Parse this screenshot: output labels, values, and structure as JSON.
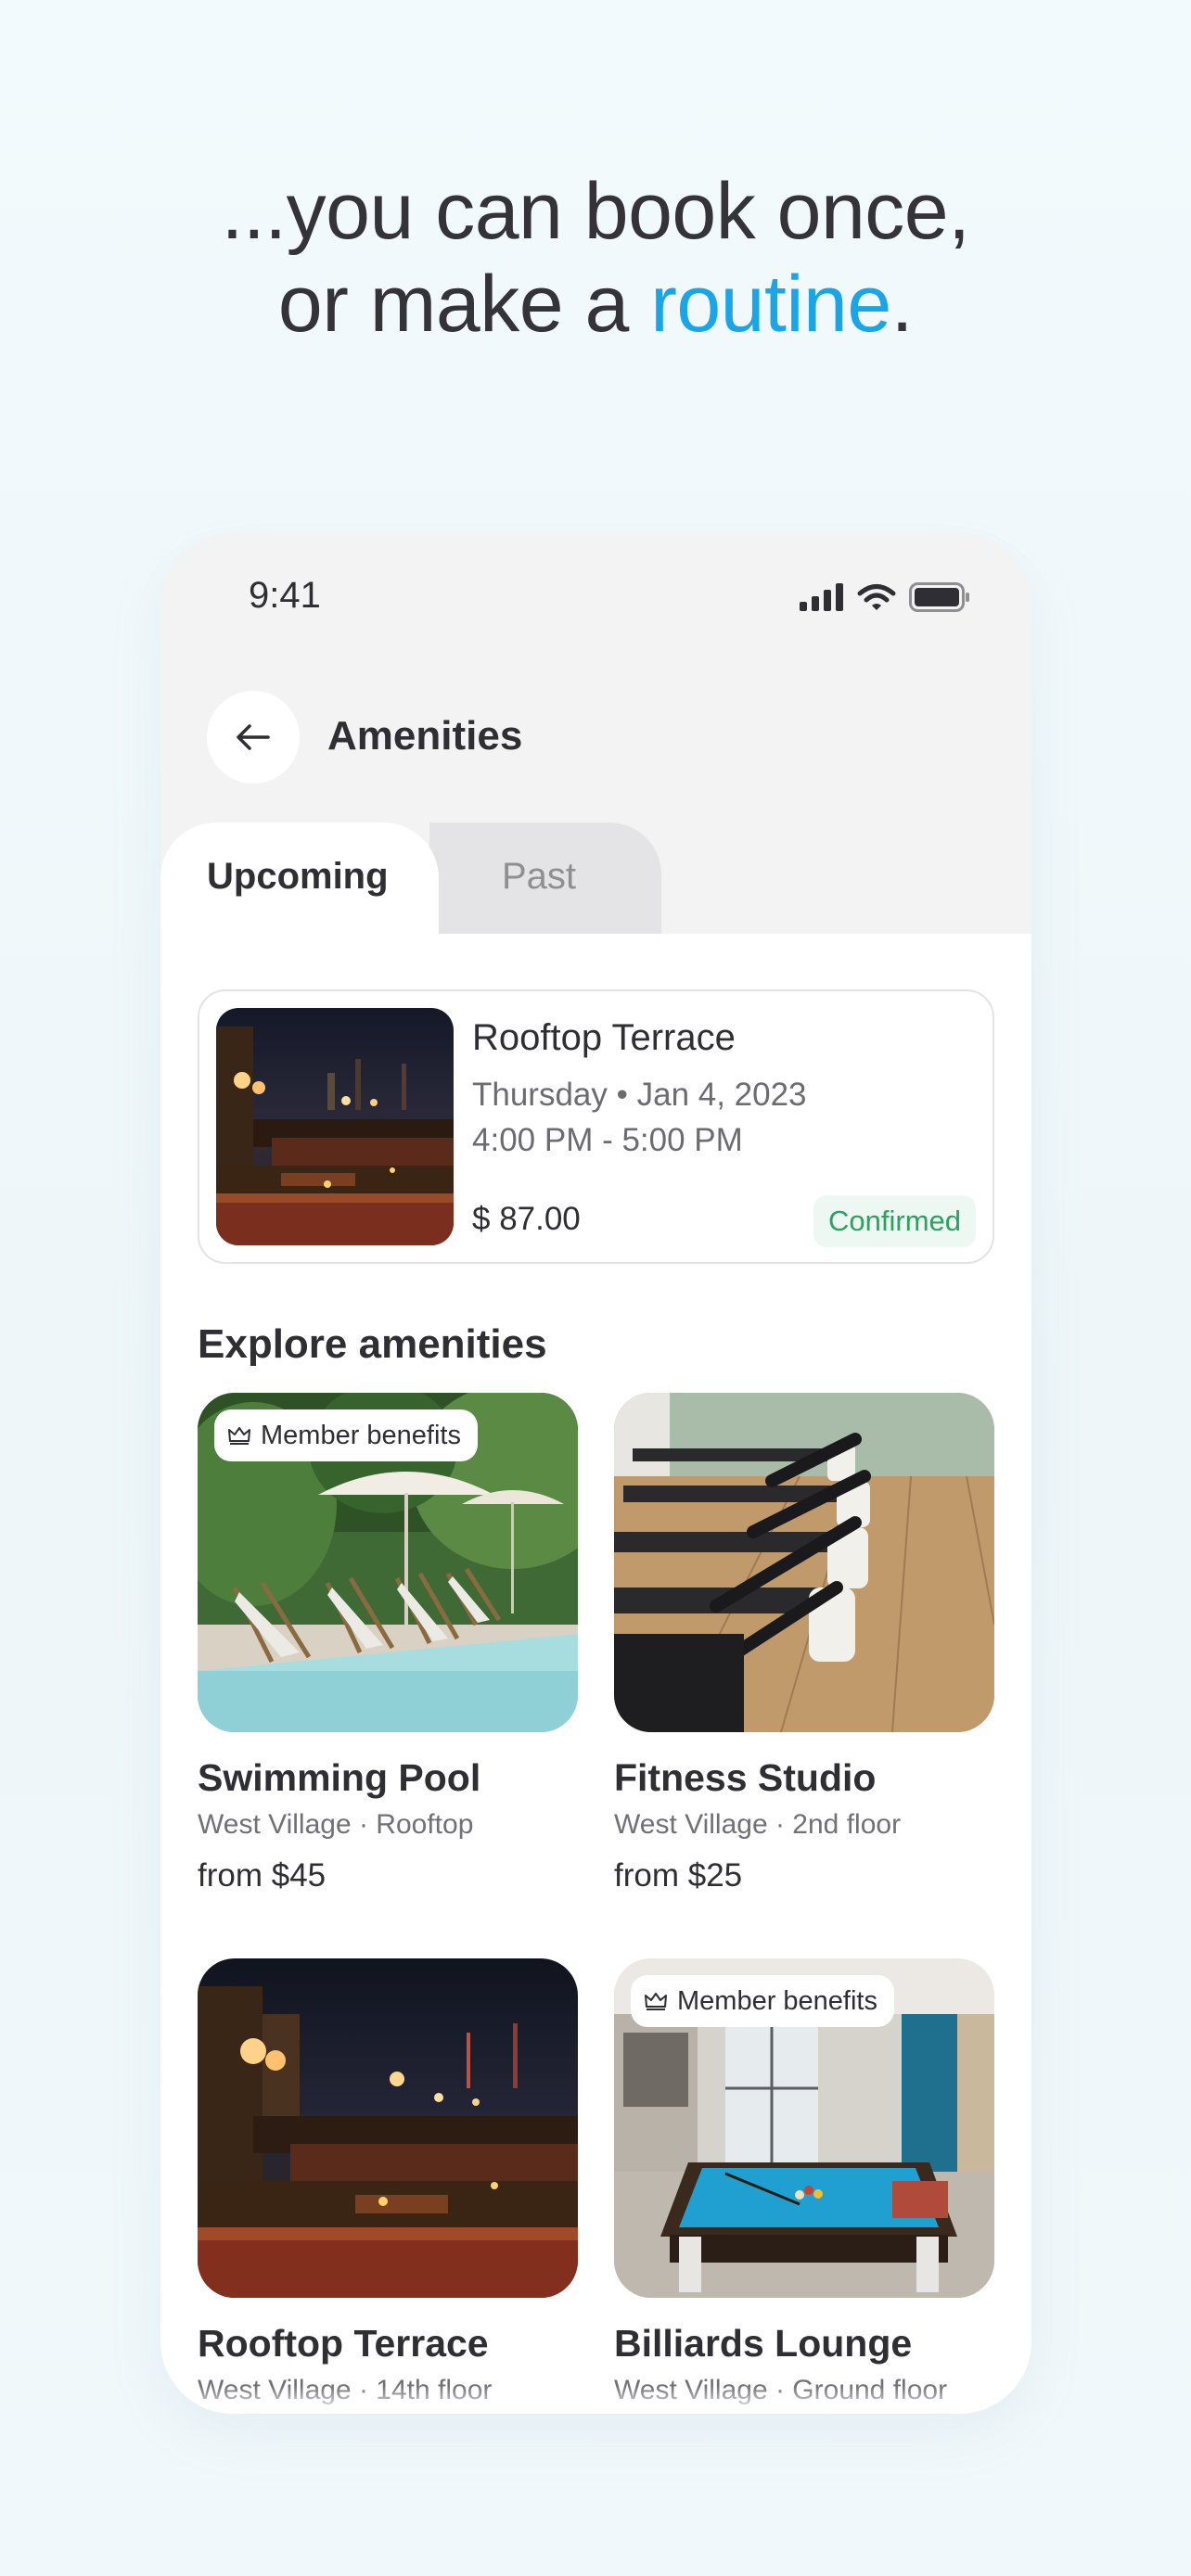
{
  "headline": {
    "line1": "...you can book once,",
    "line2_prefix": "or make a ",
    "line2_accent": "routine",
    "line2_suffix": "."
  },
  "colors": {
    "accent": "#1aa6e6",
    "confirmed_text": "#29a35e",
    "confirmed_bg": "#eef8f2",
    "text": "#2f2f33",
    "muted": "#6c6c70"
  },
  "status_bar": {
    "time": "9:41",
    "icons": [
      "signal-icon",
      "wifi-icon",
      "battery-icon"
    ]
  },
  "header": {
    "back_icon": "arrow-left-icon",
    "title": "Amenities"
  },
  "tabs": {
    "upcoming": "Upcoming",
    "past": "Past",
    "active": "Upcoming"
  },
  "booking": {
    "title": "Rooftop Terrace",
    "date": "Thursday • Jan 4, 2023",
    "time": "4:00 PM - 5:00 PM",
    "price": "$ 87.00",
    "status": "Confirmed"
  },
  "explore": {
    "title": "Explore amenities",
    "items": [
      {
        "name": "Swimming Pool",
        "location": "West Village · Rooftop",
        "price": "from $45",
        "badge": "Member benefits"
      },
      {
        "name": "Fitness Studio",
        "location": "West Village · 2nd floor",
        "price": "from $25",
        "badge": ""
      },
      {
        "name": "Rooftop Terrace",
        "location": "West Village · 14th floor",
        "price": "",
        "badge": ""
      },
      {
        "name": "Billiards Lounge",
        "location": "West Village · Ground floor",
        "price": "",
        "badge": "Member benefits"
      }
    ]
  }
}
